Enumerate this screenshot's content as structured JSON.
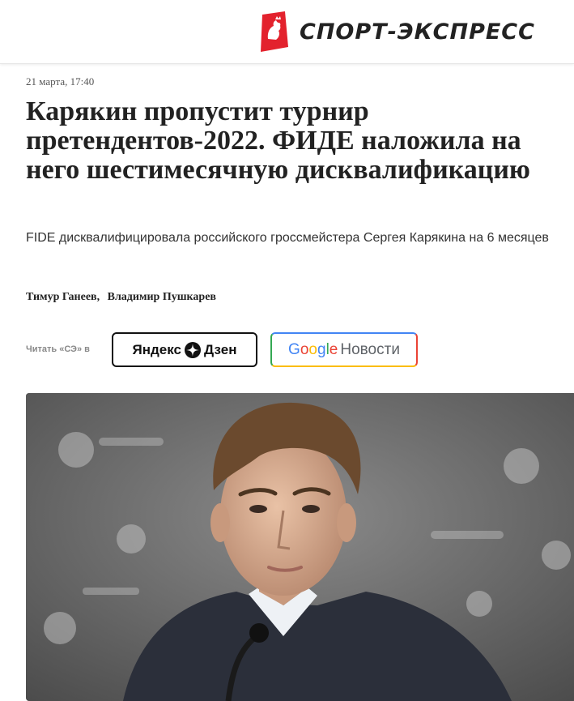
{
  "header": {
    "logo_text": "СПОРТ-ЭКСПРЕСС",
    "brand_color": "#e3222d"
  },
  "article": {
    "date": "21 марта, 17:40",
    "headline": "Карякин пропустит турнир претендентов-2022. ФИДЕ наложила на него шестимесячную дисквалификацию",
    "lead": "FIDE дисквалифицировала российского гроссмейстера Сергея Карякина на 6 месяцев",
    "authors": [
      "Тимур Ганеев",
      "Владимир Пушкарев"
    ],
    "author_separator": ","
  },
  "subscribe": {
    "label": "Читать «СЭ» в",
    "dzen": {
      "part1": "Яндекс",
      "part2": "Дзен",
      "icon": "dzen-star-icon"
    },
    "google": {
      "letters": [
        "G",
        "o",
        "o",
        "g",
        "l",
        "e"
      ],
      "letter_colors": [
        "#4285F4",
        "#EA4335",
        "#FBBC05",
        "#4285F4",
        "#34A853",
        "#EA4335"
      ],
      "news": "Новости"
    }
  },
  "photo": {
    "subject": "portrait of a chess grandmaster at a press conference with a microphone"
  }
}
